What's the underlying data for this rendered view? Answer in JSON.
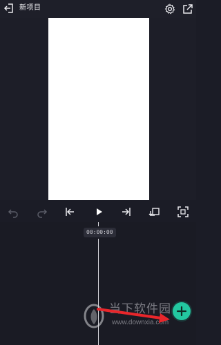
{
  "topbar": {
    "title": "新项目",
    "icons": {
      "exit": "exit-icon",
      "settings": "gear-icon",
      "export": "export-icon"
    }
  },
  "controls": {
    "icons": [
      "undo-icon",
      "redo-icon",
      "skip-to-start-icon",
      "play-icon",
      "skip-to-end-icon",
      "rotate-icon",
      "fullscreen-icon"
    ]
  },
  "timeline": {
    "timecode": "00:00:00"
  },
  "watermark": {
    "name": "当下软件园",
    "url": "www.downxia.com"
  },
  "colors": {
    "background": "#1b1c26",
    "accent": "#23c7a0",
    "annotation_arrow": "#e8262b"
  }
}
